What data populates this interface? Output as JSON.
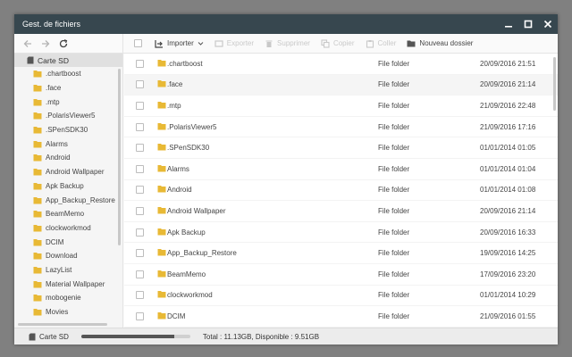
{
  "window": {
    "title": "Gest. de fichiers"
  },
  "toolbar": {
    "import_label": "Importer",
    "export_label": "Exporter",
    "delete_label": "Supprimer",
    "copy_label": "Copier",
    "paste_label": "Coller",
    "new_folder_label": "Nouveau dossier"
  },
  "sidebar": {
    "root_label": "Carte SD",
    "items": [
      ".chartboost",
      ".face",
      ".mtp",
      ".PolarisViewer5",
      ".SPenSDK30",
      "Alarms",
      "Android",
      "Android Wallpaper",
      "Apk Backup",
      "App_Backup_Restore",
      "BeamMemo",
      "clockworkmod",
      "DCIM",
      "Download",
      "LazyList",
      "Material Wallpaper",
      "mobogenie",
      "Movies"
    ]
  },
  "files": [
    {
      "name": ".chartboost",
      "type": "File folder",
      "date": "20/09/2016 21:51"
    },
    {
      "name": ".face",
      "type": "File folder",
      "date": "20/09/2016 21:14"
    },
    {
      "name": ".mtp",
      "type": "File folder",
      "date": "21/09/2016 22:48"
    },
    {
      "name": ".PolarisViewer5",
      "type": "File folder",
      "date": "21/09/2016 17:16"
    },
    {
      "name": ".SPenSDK30",
      "type": "File folder",
      "date": "01/01/2014 01:05"
    },
    {
      "name": "Alarms",
      "type": "File folder",
      "date": "01/01/2014 01:04"
    },
    {
      "name": "Android",
      "type": "File folder",
      "date": "01/01/2014 01:08"
    },
    {
      "name": "Android Wallpaper",
      "type": "File folder",
      "date": "20/09/2016 21:14"
    },
    {
      "name": "Apk Backup",
      "type": "File folder",
      "date": "20/09/2016 16:33"
    },
    {
      "name": "App_Backup_Restore",
      "type": "File folder",
      "date": "19/09/2016 14:25"
    },
    {
      "name": "BeamMemo",
      "type": "File folder",
      "date": "17/09/2016 23:20"
    },
    {
      "name": "clockworkmod",
      "type": "File folder",
      "date": "01/01/2014 10:29"
    },
    {
      "name": "DCIM",
      "type": "File folder",
      "date": "21/09/2016 01:55"
    }
  ],
  "status": {
    "drive_label": "Carte SD",
    "usage_fraction": 0.85,
    "summary": "Total : 11.13GB, Disponible : 9.51GB"
  },
  "colors": {
    "titlebar": "#37474f",
    "folder": "#e8b835"
  },
  "icons": {
    "back": "arrow-left-icon",
    "forward": "arrow-right-icon",
    "refresh": "refresh-icon",
    "import": "import-icon",
    "folder": "folder-icon",
    "sd": "sd-card-icon"
  }
}
